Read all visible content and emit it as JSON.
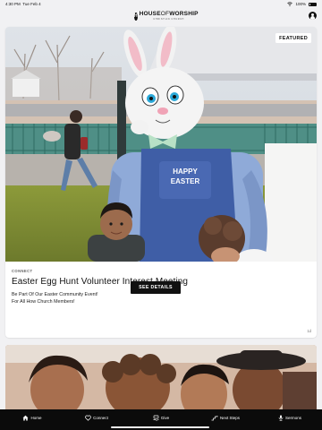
{
  "status_bar": {
    "time": "4:30 PM",
    "date": "Tue Feb 4",
    "battery": "100%",
    "icons": [
      "wifi-icon",
      "battery-icon"
    ]
  },
  "header": {
    "logo_mark": "H",
    "logo_word_bold": "HOUSE",
    "logo_word_thin": "OF",
    "logo_word_end": "WORSHIP",
    "logo_tagline": "CHRISTIAN CHURCH",
    "profile_icon": "person-icon"
  },
  "card": {
    "badge": "FEATURED",
    "kicker": "CONNECT",
    "title": "Easter Egg Hunt Volunteer Interest Meeting",
    "line1": "Be Part Of Our Easter Community Event!",
    "line2": "For All How Church Members!",
    "button": "SEE DETAILS",
    "age": "1d",
    "apron_text_1": "HAPPY",
    "apron_text_2": "EASTER"
  },
  "tabs": [
    {
      "label": "Home",
      "icon": "home-icon"
    },
    {
      "label": "Connect",
      "icon": "heart-icon"
    },
    {
      "label": "Give",
      "icon": "give-icon"
    },
    {
      "label": "Next Steps",
      "icon": "steps-icon"
    },
    {
      "label": "Sermons",
      "icon": "sermon-icon"
    }
  ],
  "colors": {
    "tab_bar": "#0b0b0b",
    "background": "#f1f1f3",
    "button": "#111111"
  }
}
